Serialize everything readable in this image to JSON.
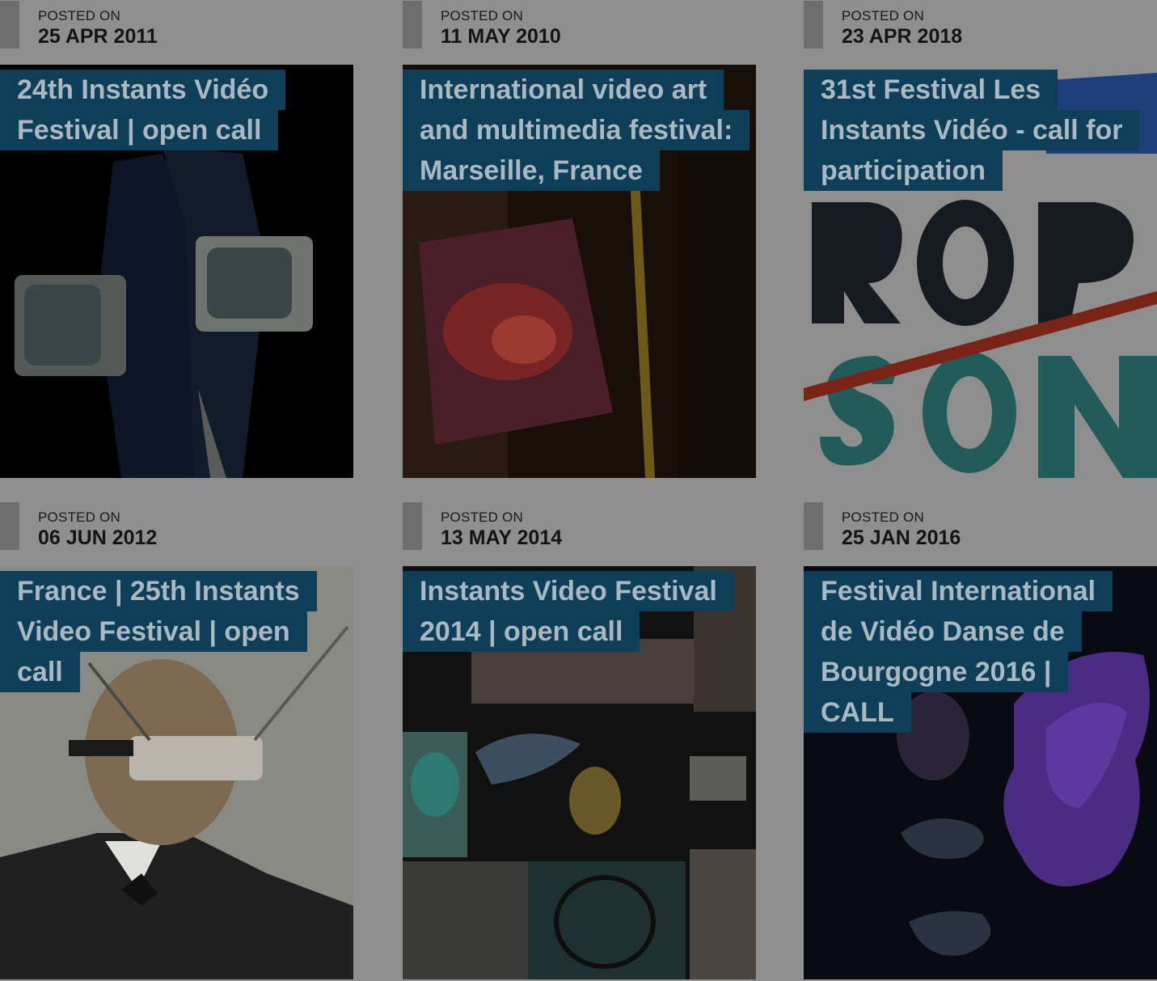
{
  "posted_label": "POSTED ON",
  "cards": [
    {
      "date": "25 APR 2011",
      "title_lines": [
        "24th Instants Vidéo",
        "Festival | open call"
      ],
      "image_icon": "vintage-tv-couple-image"
    },
    {
      "date": "11 MAY 2010",
      "title_lines": [
        "International video art",
        "and multimedia festival:",
        "Marseille, France"
      ],
      "image_icon": "installation-projection-image"
    },
    {
      "date": "23 APR 2018",
      "title_lines": [
        "31st Festival Les",
        "Instants Vidéo - call for",
        "participation"
      ],
      "image_icon": "typographic-poster-image"
    },
    {
      "date": "06 JUN 2012",
      "title_lines": [
        "France | 25th Instants",
        "Video Festival | open",
        "call"
      ],
      "image_icon": "tv-goggles-man-image"
    },
    {
      "date": "13 MAY 2014",
      "title_lines": [
        "Instants Video Festival",
        "2014 | open call"
      ],
      "image_icon": "video-collage-image"
    },
    {
      "date": "25 JAN 2016",
      "title_lines": [
        "Festival International",
        "de Vidéo Danse de",
        "Bourgogne 2016 |",
        "CALL"
      ],
      "image_icon": "purple-dance-image"
    }
  ],
  "colors": {
    "title_bg": "#0f3e58",
    "title_text": "#a9b9c4",
    "overlay": "#8f8f8f"
  }
}
